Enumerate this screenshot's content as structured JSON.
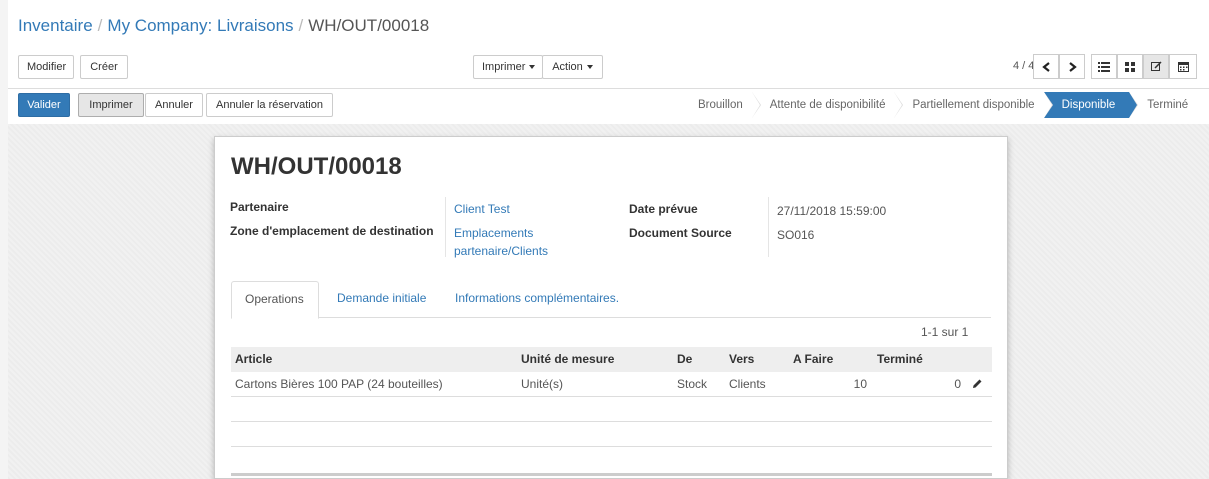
{
  "breadcrumb": {
    "items": [
      "Inventaire",
      "My Company: Livraisons"
    ],
    "separator": "/",
    "current": "WH/OUT/00018"
  },
  "toolbar": {
    "edit_label": "Modifier",
    "create_label": "Créer",
    "print_label": "Imprimer",
    "action_label": "Action"
  },
  "pager": {
    "value": "4 / 4",
    "prev_icon": "chevron-left-icon",
    "next_icon": "chevron-right-icon"
  },
  "views": {
    "list_icon": "list-view-icon",
    "kanban_icon": "kanban-view-icon",
    "form_icon": "form-view-icon",
    "calendar_icon": "calendar-view-icon",
    "active": "form"
  },
  "actions": {
    "validate_label": "Valider",
    "print_label": "Imprimer",
    "cancel_label": "Annuler",
    "unreserve_label": "Annuler la réservation"
  },
  "status": {
    "stages": [
      "Brouillon",
      "Attente de disponibilité",
      "Partiellement disponible",
      "Disponible",
      "Terminé"
    ],
    "current": "Disponible"
  },
  "form": {
    "title": "WH/OUT/00018",
    "partner_label": "Partenaire",
    "partner_value": "Client Test",
    "dest_label": "Zone d'emplacement de destination",
    "dest_value_line1": "Emplacements",
    "dest_value_line2": "partenaire/Clients",
    "date_label": "Date prévue",
    "date_value": "27/11/2018 15:59:00",
    "source_label": "Document Source",
    "source_value": "SO016"
  },
  "tabs": [
    {
      "label": "Operations"
    },
    {
      "label": "Demande initiale"
    },
    {
      "label": "Informations complémentaires."
    }
  ],
  "list": {
    "pager": "1-1 sur 1",
    "columns": [
      "Article",
      "Unité de mesure",
      "De",
      "Vers",
      "A Faire",
      "Terminé"
    ],
    "rows": [
      {
        "article": "Cartons Bières 100 PAP (24 bouteilles)",
        "uom": "Unité(s)",
        "from": "Stock",
        "to": "Clients",
        "todo": "10",
        "done": "0",
        "edit_icon": "pencil-icon"
      }
    ]
  },
  "colors": {
    "primary": "#337ab7",
    "link": "#337ab7",
    "text": "#4c4c4c"
  }
}
